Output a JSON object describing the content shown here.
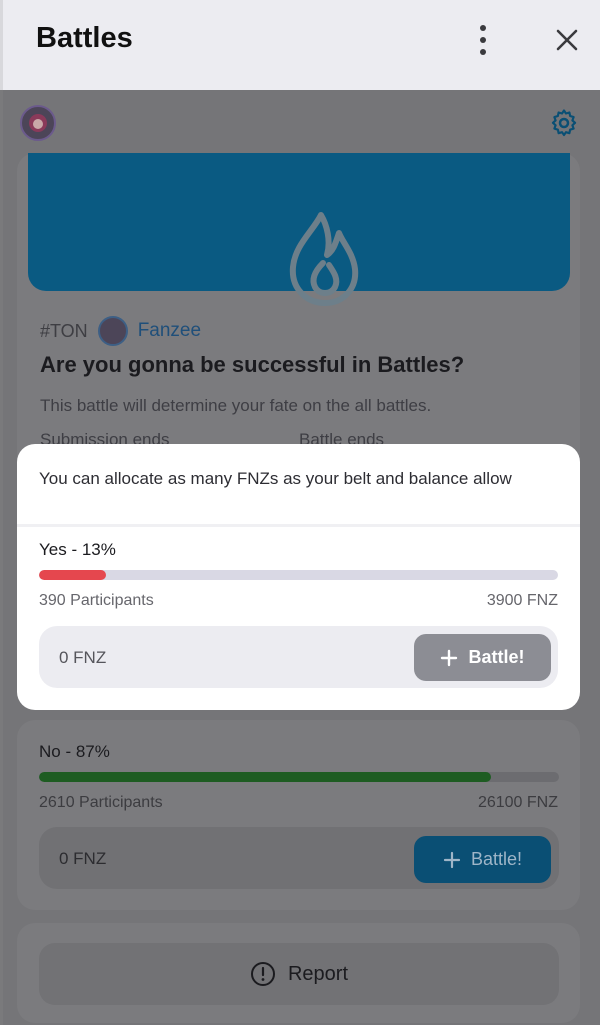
{
  "header": {
    "title": "Battles"
  },
  "battle": {
    "tag": "#TON",
    "brand": "Fanzee",
    "question": "Are you gonna be successful in Battles?",
    "description": "This battle will determine your fate on the all battles.",
    "submission_label": "Submission ends",
    "battle_end_label": "Battle ends"
  },
  "modal": {
    "note": "You can allocate as many FNZs as your belt and balance allow",
    "option": {
      "label": "Yes - 13%",
      "percent": 13,
      "participants": "390 Participants",
      "amount": "3900 FNZ",
      "input_value": "0 FNZ",
      "button_label": "Battle!"
    }
  },
  "option_no": {
    "label": "No - 87%",
    "percent": 87,
    "participants": "2610 Participants",
    "amount": "26100 FNZ",
    "input_value": "0 FNZ",
    "button_label": "Battle!"
  },
  "report": {
    "label": "Report"
  },
  "colors": {
    "yes_bar": "#e5474e",
    "no_bar": "#1e5c22",
    "banner": "#0a5a82"
  },
  "icons": [
    "more-vertical-icon",
    "close-icon",
    "avatar",
    "gear-icon",
    "flame-icon",
    "plus-icon",
    "alert-circle-icon"
  ]
}
